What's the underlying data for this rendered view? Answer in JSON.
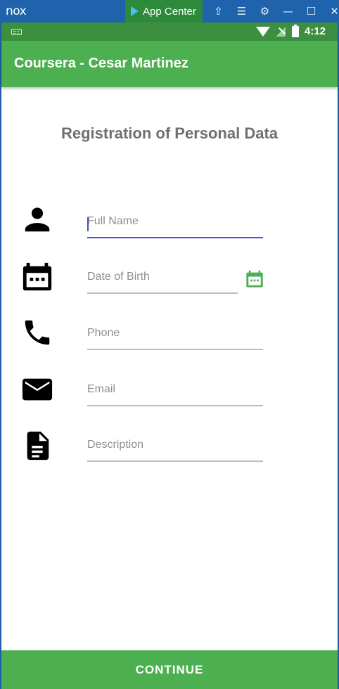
{
  "emulator": {
    "logo": "nox",
    "app_center_label": "App Center",
    "controls": [
      {
        "icon": "shirt-icon",
        "glyph": "⇧"
      },
      {
        "icon": "menu-icon",
        "glyph": "☰"
      },
      {
        "icon": "settings-icon",
        "glyph": "⚙"
      },
      {
        "icon": "minimize-icon",
        "glyph": "—"
      },
      {
        "icon": "maximize-icon",
        "glyph": "☐"
      },
      {
        "icon": "close-icon",
        "glyph": "✕"
      }
    ]
  },
  "status_bar": {
    "time": "4:12",
    "icons": [
      "keyboard-icon",
      "wifi-icon",
      "signal-icon",
      "battery-icon"
    ]
  },
  "toolbar": {
    "title": "Coursera - Cesar Martinez",
    "color": "#4caf50"
  },
  "form": {
    "title": "Registration of Personal Data",
    "fields": {
      "full_name": {
        "placeholder": "Full Name",
        "icon": "person-icon"
      },
      "date_of_birth": {
        "placeholder": "Date of Birth",
        "icon": "calendar-icon"
      },
      "phone": {
        "placeholder": "Phone",
        "icon": "phone-icon"
      },
      "email": {
        "placeholder": "Email",
        "icon": "email-icon"
      },
      "description": {
        "placeholder": "Description",
        "icon": "document-icon"
      }
    },
    "continue_label": "CONTINUE"
  },
  "colors": {
    "accent": "#4caf50",
    "focus": "#3f51d5",
    "status_bar": "#3c8f3f"
  }
}
